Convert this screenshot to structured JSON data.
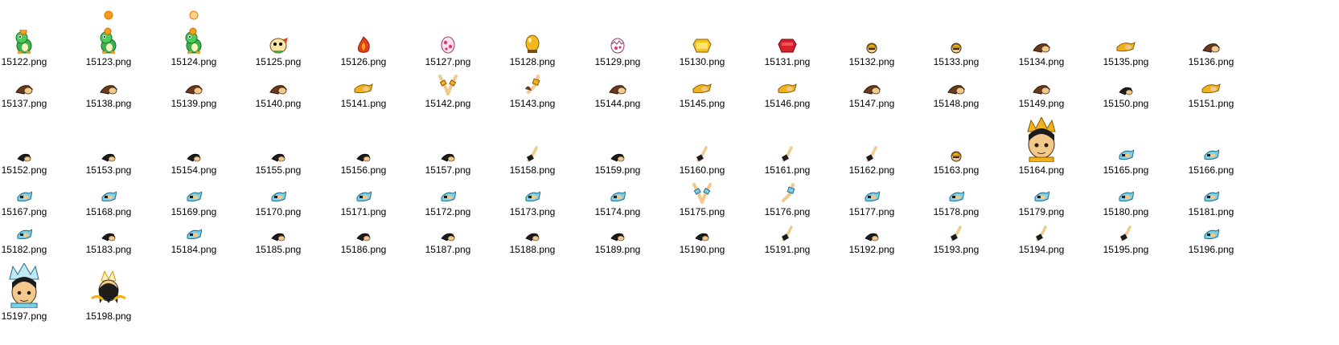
{
  "files": [
    {
      "name": "15122.png",
      "icon": "green-dragon-icon"
    },
    {
      "name": "15123.png",
      "icon": "green-dragon-with-orb-icon"
    },
    {
      "name": "15124.png",
      "icon": "green-dragon-with-sun-icon"
    },
    {
      "name": "15125.png",
      "icon": "baby-dragon-icon"
    },
    {
      "name": "15126.png",
      "icon": "fire-creature-icon"
    },
    {
      "name": "15127.png",
      "icon": "pink-spotted-egg-icon"
    },
    {
      "name": "15128.png",
      "icon": "golden-egg-icon"
    },
    {
      "name": "15129.png",
      "icon": "cracked-egg-icon"
    },
    {
      "name": "15130.png",
      "icon": "gold-gem-icon"
    },
    {
      "name": "15131.png",
      "icon": "red-gem-icon"
    },
    {
      "name": "15132.png",
      "icon": "gold-helmet-head-icon"
    },
    {
      "name": "15133.png",
      "icon": "gold-helmet-head-icon"
    },
    {
      "name": "15134.png",
      "icon": "brown-hair-sprite-icon"
    },
    {
      "name": "15135.png",
      "icon": "gold-armor-piece-icon"
    },
    {
      "name": "15136.png",
      "icon": "brown-hair-sprite-icon"
    },
    {
      "name": "15137.png",
      "icon": "brown-hair-sprite-icon"
    },
    {
      "name": "15138.png",
      "icon": "brown-hair-sprite-icon"
    },
    {
      "name": "15139.png",
      "icon": "brown-hair-sprite-icon"
    },
    {
      "name": "15140.png",
      "icon": "brown-hair-sprite-icon"
    },
    {
      "name": "15141.png",
      "icon": "gold-armor-piece-icon"
    },
    {
      "name": "15142.png",
      "icon": "gold-arms-raised-icon"
    },
    {
      "name": "15143.png",
      "icon": "gold-arm-sprite-icon"
    },
    {
      "name": "15144.png",
      "icon": "brown-hair-sprite-icon"
    },
    {
      "name": "15145.png",
      "icon": "gold-armor-piece-icon"
    },
    {
      "name": "15146.png",
      "icon": "gold-armor-piece-icon"
    },
    {
      "name": "15147.png",
      "icon": "brown-hair-sprite-icon"
    },
    {
      "name": "15148.png",
      "icon": "brown-hair-sprite-icon"
    },
    {
      "name": "15149.png",
      "icon": "brown-hair-sprite-icon"
    },
    {
      "name": "15150.png",
      "icon": "dark-hair-sprite-icon"
    },
    {
      "name": "15151.png",
      "icon": "gold-armor-piece-icon"
    },
    {
      "name": "15152.png",
      "icon": "dark-hair-sprite-icon"
    },
    {
      "name": "15153.png",
      "icon": "dark-hair-sprite-icon"
    },
    {
      "name": "15154.png",
      "icon": "dark-hair-sprite-icon"
    },
    {
      "name": "15155.png",
      "icon": "dark-hair-sprite-icon"
    },
    {
      "name": "15156.png",
      "icon": "dark-hair-sprite-icon"
    },
    {
      "name": "15157.png",
      "icon": "dark-hair-sprite-icon"
    },
    {
      "name": "15158.png",
      "icon": "dark-arm-sprite-icon"
    },
    {
      "name": "15159.png",
      "icon": "dark-hair-sprite-icon"
    },
    {
      "name": "15160.png",
      "icon": "dark-arm-sprite-icon"
    },
    {
      "name": "15161.png",
      "icon": "dark-arm-sprite-icon"
    },
    {
      "name": "15162.png",
      "icon": "dark-arm-sprite-icon"
    },
    {
      "name": "15163.png",
      "icon": "gold-helmet-head-icon"
    },
    {
      "name": "15164.png",
      "icon": "gold-warrior-portrait-icon"
    },
    {
      "name": "15165.png",
      "icon": "blue-armor-piece-icon"
    },
    {
      "name": "15166.png",
      "icon": "blue-armor-piece-icon"
    },
    {
      "name": "15167.png",
      "icon": "blue-armor-piece-icon"
    },
    {
      "name": "15168.png",
      "icon": "blue-armor-piece-icon"
    },
    {
      "name": "15169.png",
      "icon": "blue-armor-piece-icon"
    },
    {
      "name": "15170.png",
      "icon": "blue-armor-piece-icon"
    },
    {
      "name": "15171.png",
      "icon": "blue-armor-piece-icon"
    },
    {
      "name": "15172.png",
      "icon": "blue-armor-piece-icon"
    },
    {
      "name": "15173.png",
      "icon": "blue-armor-piece-icon"
    },
    {
      "name": "15174.png",
      "icon": "blue-armor-piece-icon"
    },
    {
      "name": "15175.png",
      "icon": "blue-arms-raised-icon"
    },
    {
      "name": "15176.png",
      "icon": "blue-arm-sprite-icon"
    },
    {
      "name": "15177.png",
      "icon": "blue-armor-piece-icon"
    },
    {
      "name": "15178.png",
      "icon": "blue-armor-piece-icon"
    },
    {
      "name": "15179.png",
      "icon": "blue-armor-piece-icon"
    },
    {
      "name": "15180.png",
      "icon": "blue-armor-piece-icon"
    },
    {
      "name": "15181.png",
      "icon": "blue-armor-piece-icon"
    },
    {
      "name": "15182.png",
      "icon": "blue-armor-piece-icon"
    },
    {
      "name": "15183.png",
      "icon": "dark-hair-sprite-icon"
    },
    {
      "name": "15184.png",
      "icon": "blue-armor-piece-icon"
    },
    {
      "name": "15185.png",
      "icon": "dark-hair-sprite-icon"
    },
    {
      "name": "15186.png",
      "icon": "dark-hair-sprite-icon"
    },
    {
      "name": "15187.png",
      "icon": "dark-hair-sprite-icon"
    },
    {
      "name": "15188.png",
      "icon": "dark-hair-sprite-icon"
    },
    {
      "name": "15189.png",
      "icon": "dark-hair-sprite-icon"
    },
    {
      "name": "15190.png",
      "icon": "dark-hair-sprite-icon"
    },
    {
      "name": "15191.png",
      "icon": "dark-arm-sprite-icon"
    },
    {
      "name": "15192.png",
      "icon": "dark-hair-sprite-icon"
    },
    {
      "name": "15193.png",
      "icon": "dark-arm-sprite-icon"
    },
    {
      "name": "15194.png",
      "icon": "dark-arm-sprite-icon"
    },
    {
      "name": "15195.png",
      "icon": "dark-arm-sprite-icon"
    },
    {
      "name": "15196.png",
      "icon": "blue-armor-piece-icon"
    },
    {
      "name": "15197.png",
      "icon": "blue-warrior-portrait-icon"
    },
    {
      "name": "15198.png",
      "icon": "gold-warrior-girl-portrait-icon"
    }
  ]
}
